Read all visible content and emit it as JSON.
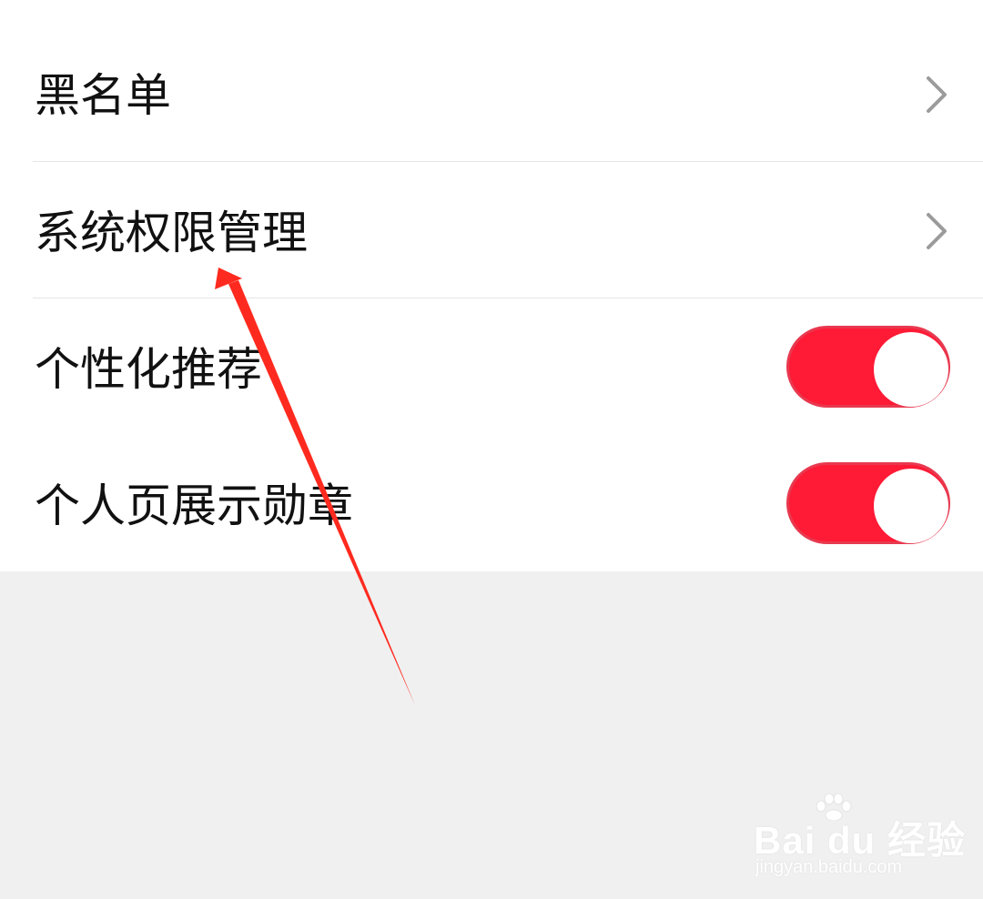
{
  "settings": {
    "items": [
      {
        "label": "黑名单",
        "control": "chevron"
      },
      {
        "label": "系统权限管理",
        "control": "chevron"
      },
      {
        "label": "个性化推荐",
        "control": "toggle",
        "enabled": true
      },
      {
        "label": "个人页展示勋章",
        "control": "toggle",
        "enabled": true
      }
    ]
  },
  "icons": {
    "chevron": "chevron-right-icon",
    "annotation": "red-arrow-annotation",
    "watermark_paw": "paw-icon"
  },
  "colors": {
    "toggle_on": "#ff1a36",
    "toggle_border": "#e8394f",
    "chevron": "#9b9b9b",
    "arrow": "#ff2a1f",
    "page_bg": "#f0f0f0",
    "card_bg": "#ffffff"
  },
  "watermark": {
    "brand": "Bai du 经验",
    "site": "jingyan.baidu.com"
  }
}
